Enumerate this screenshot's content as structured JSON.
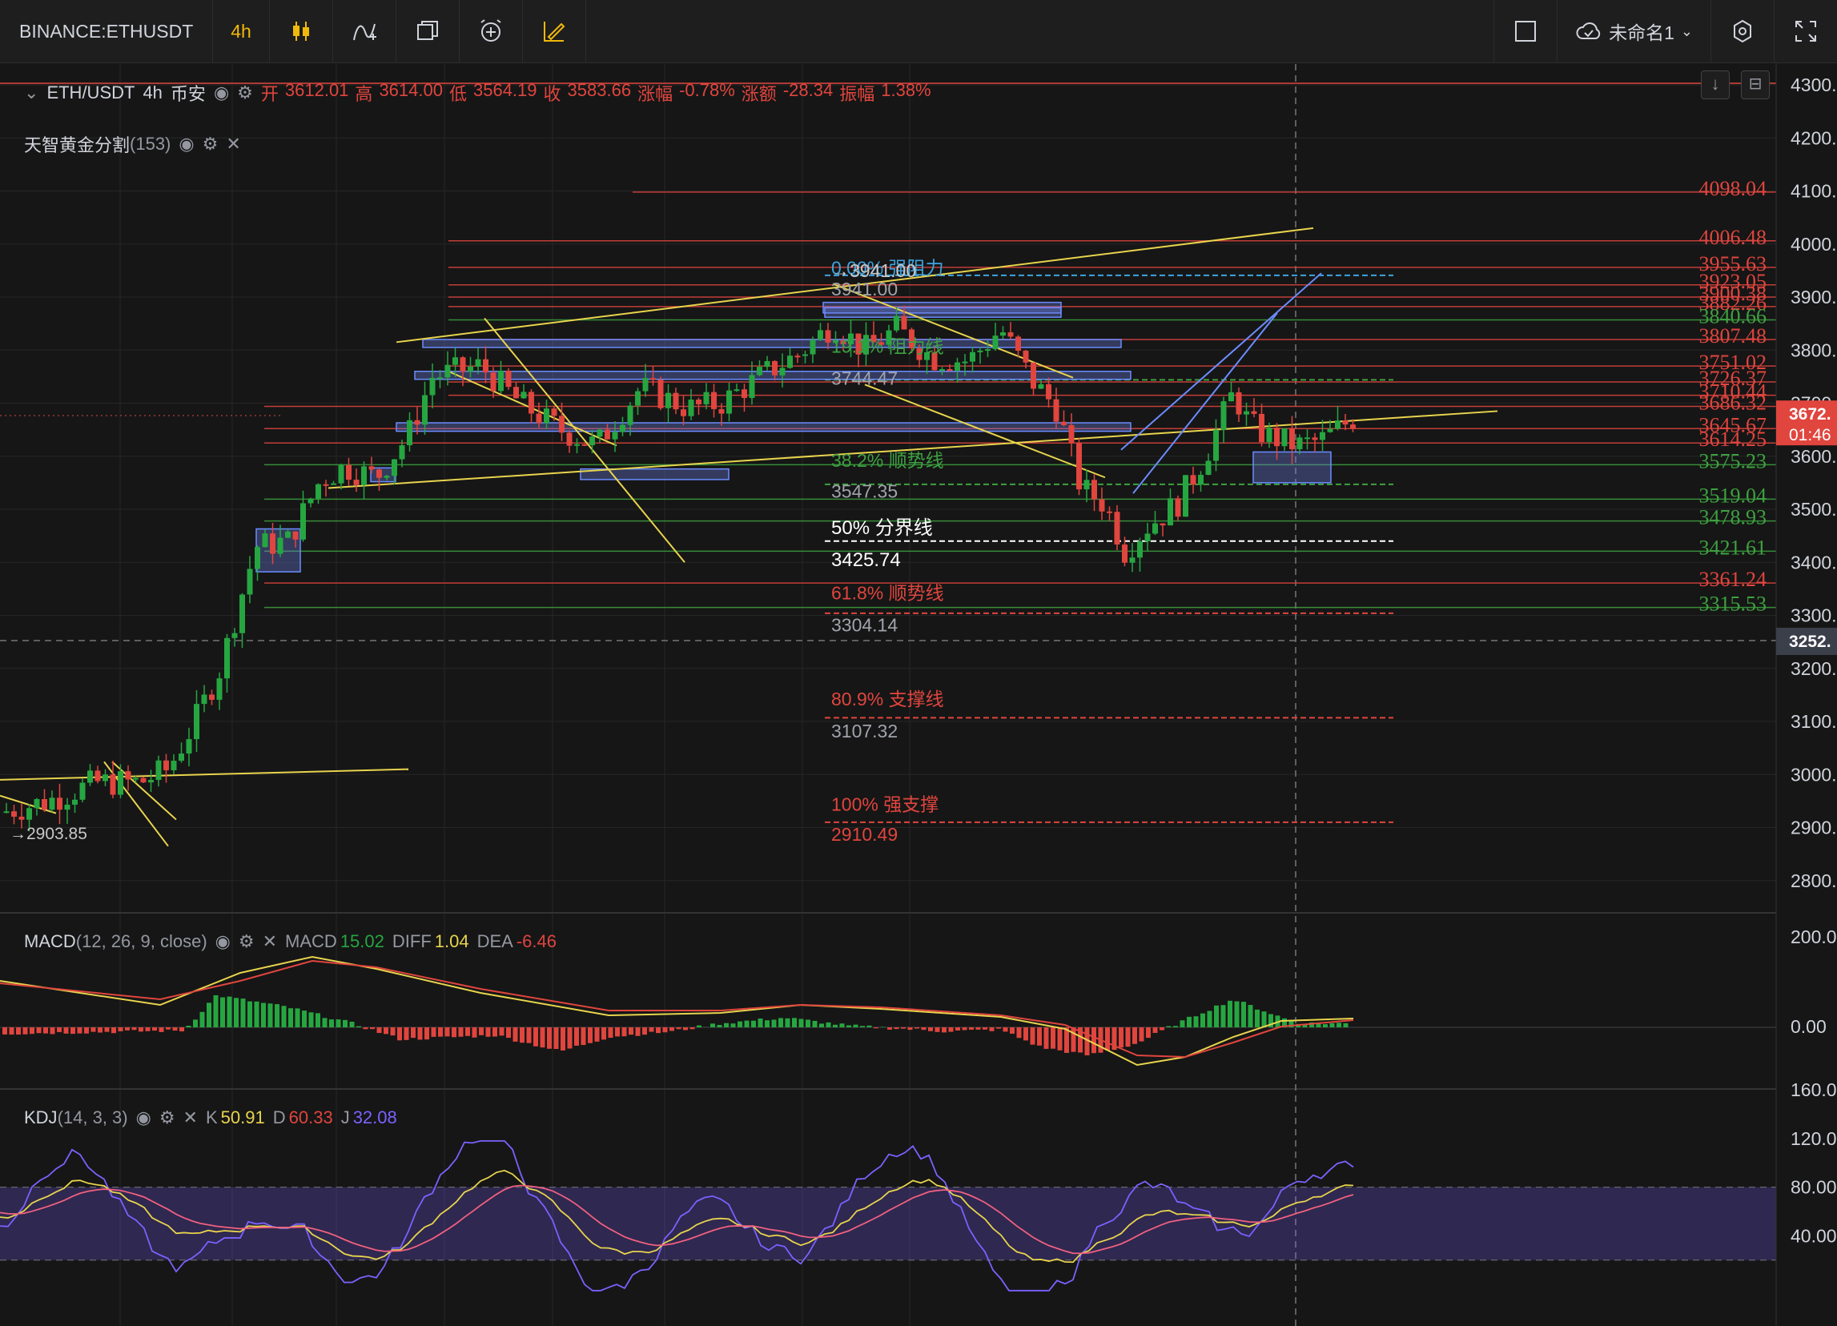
{
  "toolbar": {
    "symbol": "BINANCE:ETHUSDT",
    "interval": "4h",
    "layout_name": "未命名1"
  },
  "ohlc_legend": {
    "pair": "ETH/USDT",
    "interval": "4h",
    "exchange": "币安",
    "open_label": "开",
    "open": "3612.01",
    "high_label": "高",
    "high": "3614.00",
    "low_label": "低",
    "low": "3564.19",
    "close_label": "收",
    "close": "3583.66",
    "change_pct_label": "涨幅",
    "change_pct": "-0.78%",
    "change_label": "涨额",
    "change": "-28.34",
    "amplitude_label": "振幅",
    "amplitude": "1.38%"
  },
  "indicator_fib": {
    "name": "天智黄金分割",
    "count": "(153)"
  },
  "price_axis": {
    "ticks": [
      "4300.0",
      "4200.0",
      "4100.0",
      "4000.0",
      "3900.0",
      "3800.0",
      "3700.0",
      "3600.0",
      "3500.0",
      "3400.0",
      "3300.0",
      "3200.0",
      "3100.0",
      "3000.0",
      "2900.0",
      "2800.0"
    ],
    "current_price": "3672.",
    "countdown": "01:46",
    "crosshair_price": "3252.",
    "top_partial": "4300.00"
  },
  "fib_labels": [
    {
      "text": "0.00% 强阻力",
      "price": 3943,
      "color": "#3da4e0"
    },
    {
      "text": "→3941.00",
      "price": 3938,
      "color": "#c8c8c8"
    },
    {
      "text": "3941.00",
      "price": 3903,
      "color": "#a0a3ab"
    },
    {
      "text": "19.1% 阻力线",
      "price": 3795,
      "color": "#3da140"
    },
    {
      "text": "3744.47",
      "price": 3735,
      "color": "#a0a3ab"
    },
    {
      "text": "38.2% 顺势线",
      "price": 3580,
      "color": "#3da140"
    },
    {
      "text": "3547.35",
      "price": 3522,
      "color": "#a0a3ab"
    },
    {
      "text": "50% 分界线",
      "price": 3453,
      "color": "#ffffff"
    },
    {
      "text": "3425.74",
      "price": 3393,
      "color": "#ffffff"
    },
    {
      "text": "61.8% 顺势线",
      "price": 3330,
      "color": "#e0453e"
    },
    {
      "text": "3304.14",
      "price": 3270,
      "color": "#a0a3ab"
    },
    {
      "text": "80.9% 支撑线",
      "price": 3130,
      "color": "#e0453e"
    },
    {
      "text": "3107.32",
      "price": 3070,
      "color": "#a0a3ab"
    },
    {
      "text": "100% 强支撑",
      "price": 2932,
      "color": "#e0453e"
    },
    {
      "text": "2910.49",
      "price": 2875,
      "color": "#e0453e"
    }
  ],
  "right_levels": [
    {
      "text": "4098.04",
      "price": 4098,
      "color": "#e0453e"
    },
    {
      "text": "4006.48",
      "price": 4006,
      "color": "#e0453e"
    },
    {
      "text": "3955.63",
      "price": 3956,
      "color": "#e0453e"
    },
    {
      "text": "3923.05",
      "price": 3923,
      "color": "#e0453e"
    },
    {
      "text": "3900.38",
      "price": 3900,
      "color": "#e0453e"
    },
    {
      "text": "3882.26",
      "price": 3882,
      "color": "#e0453e"
    },
    {
      "text": "3840.66",
      "price": 3857,
      "color": "#3da140"
    },
    {
      "text": "3807.48",
      "price": 3820,
      "color": "#e0453e"
    },
    {
      "text": "3751.02",
      "price": 3770,
      "color": "#e0453e"
    },
    {
      "text": "3726.37",
      "price": 3740,
      "color": "#e0453e"
    },
    {
      "text": "3710.44",
      "price": 3715,
      "color": "#e0453e"
    },
    {
      "text": "3686.32",
      "price": 3694,
      "color": "#e0453e"
    },
    {
      "text": "3645.67",
      "price": 3652,
      "color": "#e0453e"
    },
    {
      "text": "3614.25",
      "price": 3625,
      "color": "#e0453e"
    },
    {
      "text": "3575.23",
      "price": 3584,
      "color": "#3da140"
    },
    {
      "text": "3519.04",
      "price": 3519,
      "color": "#3da140"
    },
    {
      "text": "3478.93",
      "price": 3478,
      "color": "#3da140"
    },
    {
      "text": "3421.61",
      "price": 3421,
      "color": "#3da140"
    },
    {
      "text": "3361.24",
      "price": 3361,
      "color": "#e0453e"
    },
    {
      "text": "3315.53",
      "price": 3315,
      "color": "#3da140"
    }
  ],
  "low_marker": "→2903.85",
  "macd": {
    "name": "MACD",
    "params": "(12, 26, 9, close)",
    "macd_label": "MACD",
    "macd": "15.02",
    "diff_label": "DIFF",
    "diff": "1.04",
    "dea_label": "DEA",
    "dea": "-6.46",
    "axis": [
      "200.0",
      "0.00"
    ]
  },
  "kdj": {
    "name": "KDJ",
    "params": "(14, 3, 3)",
    "k_label": "K",
    "k": "50.91",
    "d_label": "D",
    "d": "60.33",
    "j_label": "J",
    "j": "32.08",
    "axis": [
      "160.0",
      "120.0",
      "80.00",
      "40.00"
    ]
  },
  "colors": {
    "up": "#26a641",
    "down": "#e0453e",
    "yellow": "#e8d44d",
    "purple": "#7b61ff",
    "blue": "#6b8cff"
  }
}
